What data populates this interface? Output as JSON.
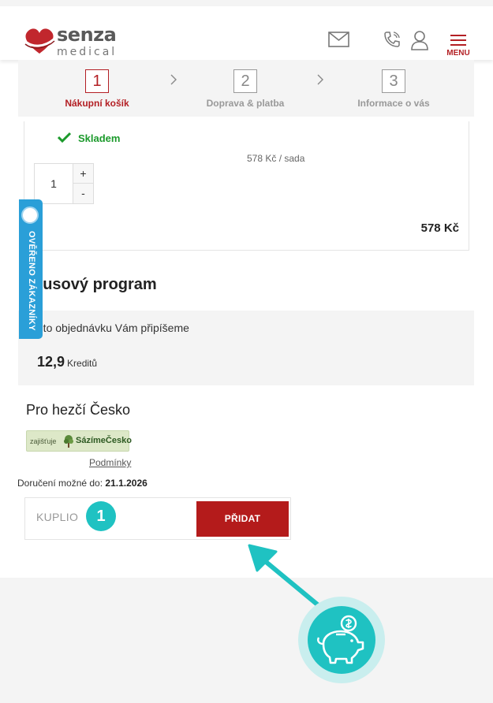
{
  "header": {
    "logo_name": "senza",
    "logo_sub": "medical",
    "menu_label": "MENU",
    "icons": [
      "mail-icon",
      "phone-icon",
      "user-icon",
      "hamburger-icon"
    ]
  },
  "steps": [
    {
      "number": "1",
      "label": "Nákupní košík",
      "active": true
    },
    {
      "number": "2",
      "label": "Doprava & platba",
      "active": false
    },
    {
      "number": "3",
      "label": "Informace o vás",
      "active": false
    }
  ],
  "product": {
    "stock": "Skladem",
    "unit_price": "578 Kč / sada",
    "quantity": "1",
    "plus": "+",
    "minus": "-",
    "total": "578 Kč"
  },
  "side_badge": {
    "label": "OVĚŘENO ZÁKAZNÍKY"
  },
  "bonus": {
    "title": "nusový program",
    "note": "tuto objednávku Vám připíšeme",
    "credits_value": "12,9",
    "credits_unit": "Kreditů"
  },
  "charity": {
    "title": "Pro hezčí Česko",
    "badge_small": "zajišťuje",
    "badge_name": "SázímeČesko",
    "conditions_link": "Podmínky"
  },
  "delivery": {
    "label": "Doručení možné do:",
    "date": "21.1.2026"
  },
  "coupon": {
    "value": "KUPLIO",
    "button": "PŘIDAT",
    "marker": "1"
  },
  "colors": {
    "brand_red": "#b31f24",
    "teal": "#1fc2c2",
    "stock_green": "#1c9a2c",
    "badge_blue": "#2a9fd8"
  }
}
